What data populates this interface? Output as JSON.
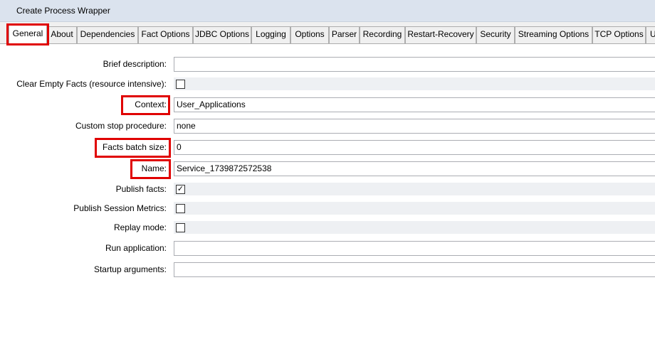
{
  "window": {
    "title": "Create Process Wrapper"
  },
  "tabs": [
    {
      "label": "General"
    },
    {
      "label": "About"
    },
    {
      "label": "Dependencies"
    },
    {
      "label": "Fact Options"
    },
    {
      "label": "JDBC Options"
    },
    {
      "label": "Logging"
    },
    {
      "label": "Options"
    },
    {
      "label": "Parser"
    },
    {
      "label": "Recording"
    },
    {
      "label": "Restart-Recovery"
    },
    {
      "label": "Security"
    },
    {
      "label": "Streaming Options"
    },
    {
      "label": "TCP Options"
    },
    {
      "label": "U"
    }
  ],
  "active_tab": "General",
  "form": {
    "brief_description": {
      "label": "Brief description:",
      "value": ""
    },
    "clear_empty_facts": {
      "label": "Clear Empty Facts (resource intensive):",
      "checked": false
    },
    "context": {
      "label": "Context:",
      "value": "User_Applications"
    },
    "custom_stop_procedure": {
      "label": "Custom stop procedure:",
      "value": "none"
    },
    "facts_batch_size": {
      "label": "Facts batch size:",
      "value": "0"
    },
    "name": {
      "label": "Name:",
      "value": "Service_1739872572538"
    },
    "publish_facts": {
      "label": "Publish facts:",
      "checked": true,
      "mark": "✓"
    },
    "publish_session_metrics": {
      "label": "Publish Session Metrics:",
      "checked": false
    },
    "replay_mode": {
      "label": "Replay mode:",
      "checked": false
    },
    "run_application": {
      "label": "Run application:",
      "value": ""
    },
    "startup_arguments": {
      "label": "Startup arguments:",
      "value": ""
    }
  },
  "colors": {
    "highlight": "#e00000",
    "titlebar": "#dbe3ee",
    "tabstrip": "#f0f0f0"
  }
}
